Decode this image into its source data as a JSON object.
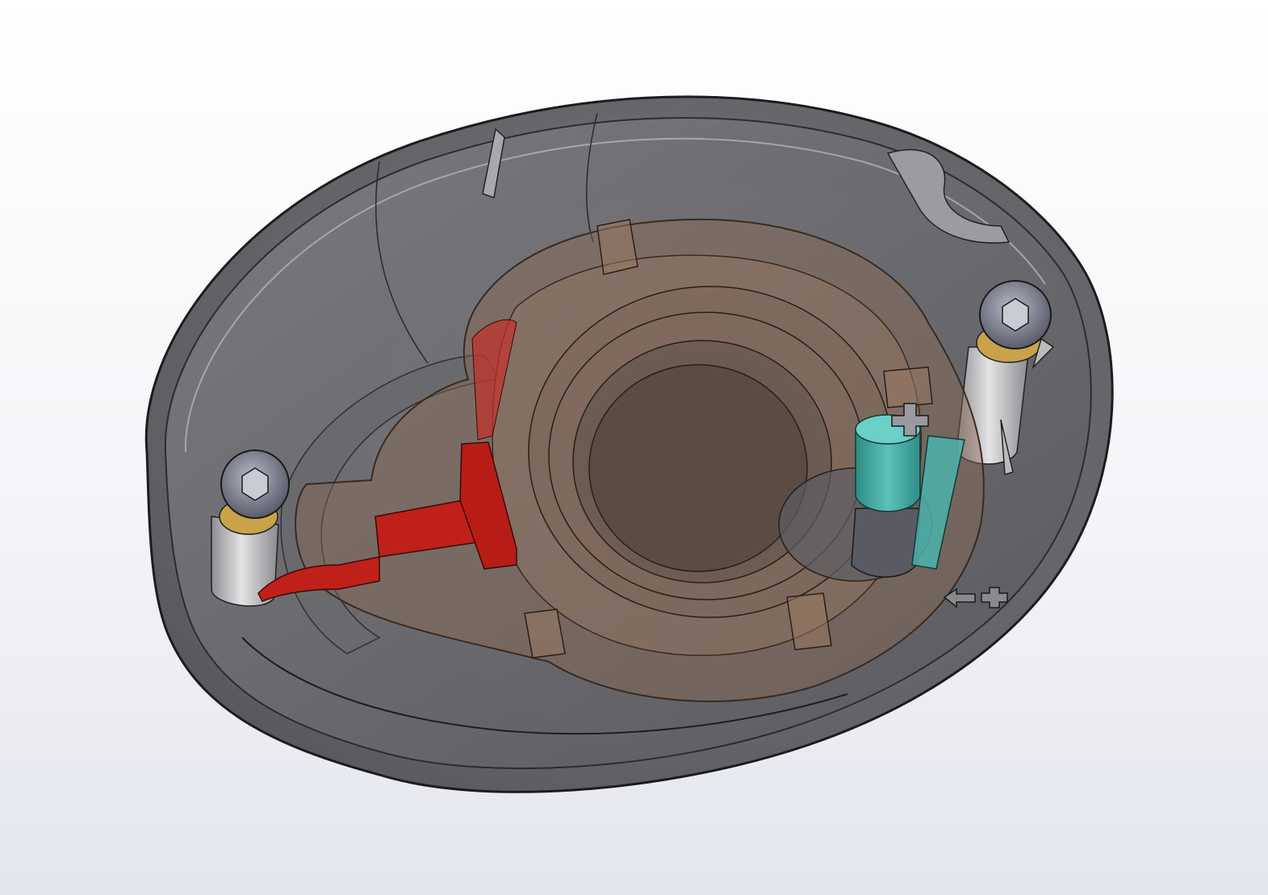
{
  "viewport": {
    "background_top": "#ffffff",
    "background_bottom": "#e3e5ee"
  },
  "model": {
    "housing": {
      "name": "housing-shell",
      "color": "#6e6e72",
      "opacity": 0.85,
      "edge_color": "#1a1a1a"
    },
    "carrier": {
      "name": "carrier-ring",
      "color": "#8a6a52",
      "opacity": 0.45
    },
    "lever": {
      "name": "red-lever",
      "color": "#c0201a"
    },
    "spring": {
      "name": "teal-spring-post",
      "color": "#3fa7a0"
    },
    "screws": [
      {
        "name": "screw-left",
        "drive": "hex-socket"
      },
      {
        "name": "screw-right",
        "drive": "hex-socket"
      }
    ],
    "marking": {
      "name": "embossed-arrow-plus-symbol",
      "symbols": [
        "arrow",
        "plus"
      ]
    }
  }
}
